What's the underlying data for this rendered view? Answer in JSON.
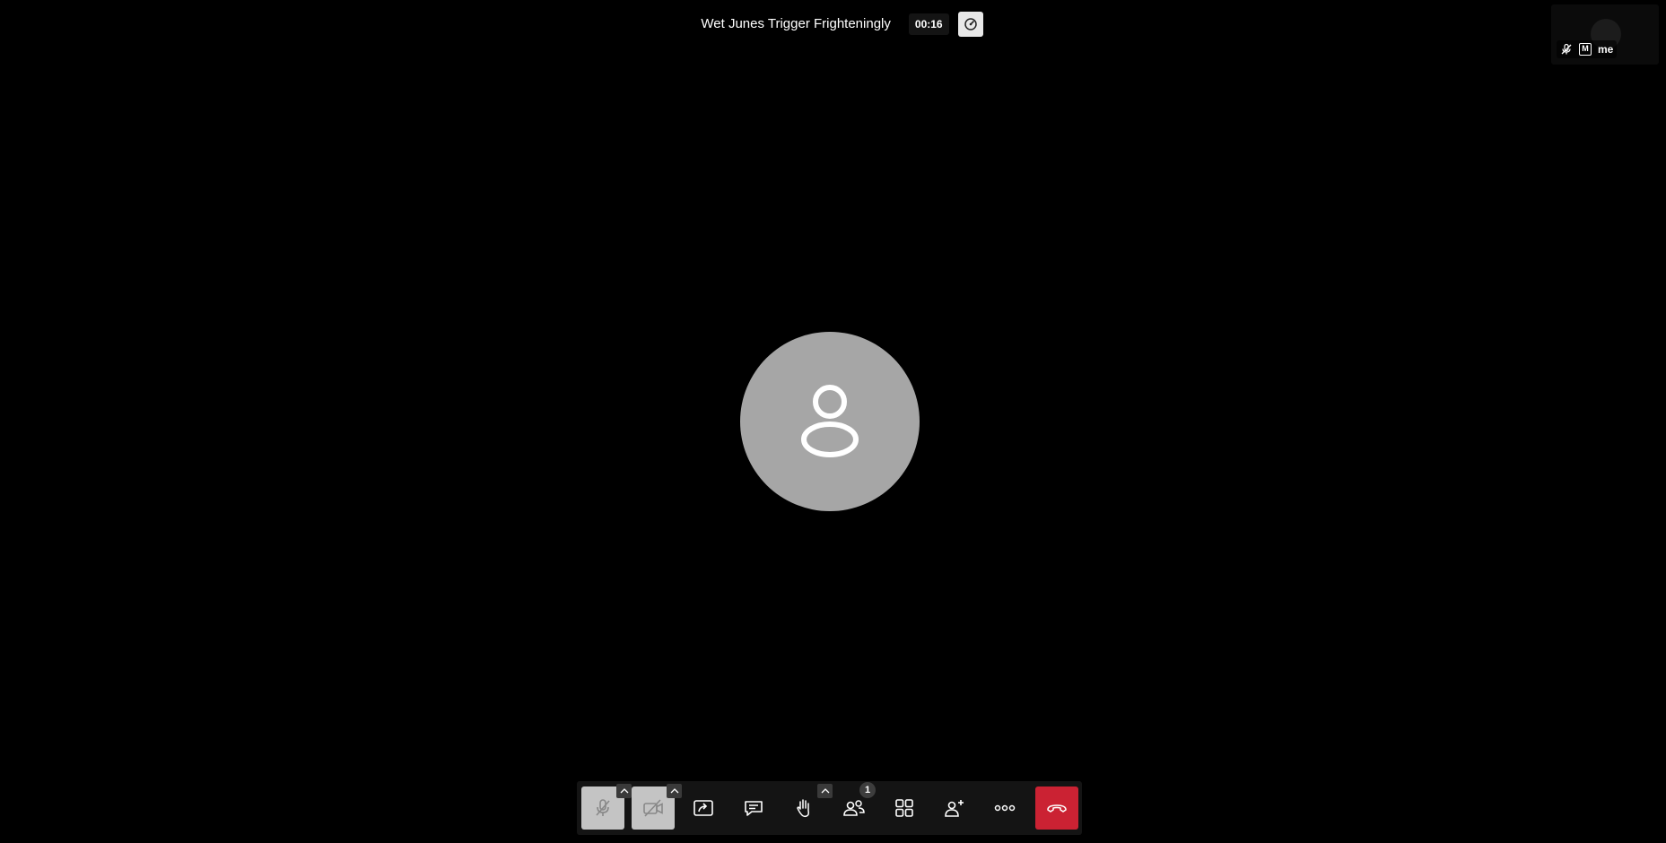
{
  "header": {
    "title": "Wet Junes Trigger Frighteningly",
    "timer": "00:16",
    "performance_icon": "gauge-icon"
  },
  "thumbnail": {
    "name": "me",
    "moderator_mark": "M",
    "mic_icon": "mic-off-icon"
  },
  "stage": {
    "avatar_icon": "user-icon"
  },
  "toolbox": {
    "items": [
      {
        "name": "microphone",
        "icon": "mic-off-icon",
        "state": "muted"
      },
      {
        "name": "camera",
        "icon": "camera-off-icon",
        "state": "muted"
      },
      {
        "name": "share-screen",
        "icon": "share-screen-icon"
      },
      {
        "name": "chat",
        "icon": "chat-icon"
      },
      {
        "name": "raise-hand",
        "icon": "hand-icon"
      },
      {
        "name": "participants",
        "icon": "participants-icon",
        "badge": "1"
      },
      {
        "name": "tile-view",
        "icon": "grid-icon"
      },
      {
        "name": "invite",
        "icon": "add-user-icon"
      },
      {
        "name": "more",
        "icon": "more-icon"
      },
      {
        "name": "hangup",
        "icon": "hangup-icon"
      }
    ]
  },
  "colors": {
    "background": "#000000",
    "toolbox": "#141414",
    "muted_button": "#c4c4c4",
    "hangup": "#cb2233",
    "avatar": "#a6a6a6"
  }
}
